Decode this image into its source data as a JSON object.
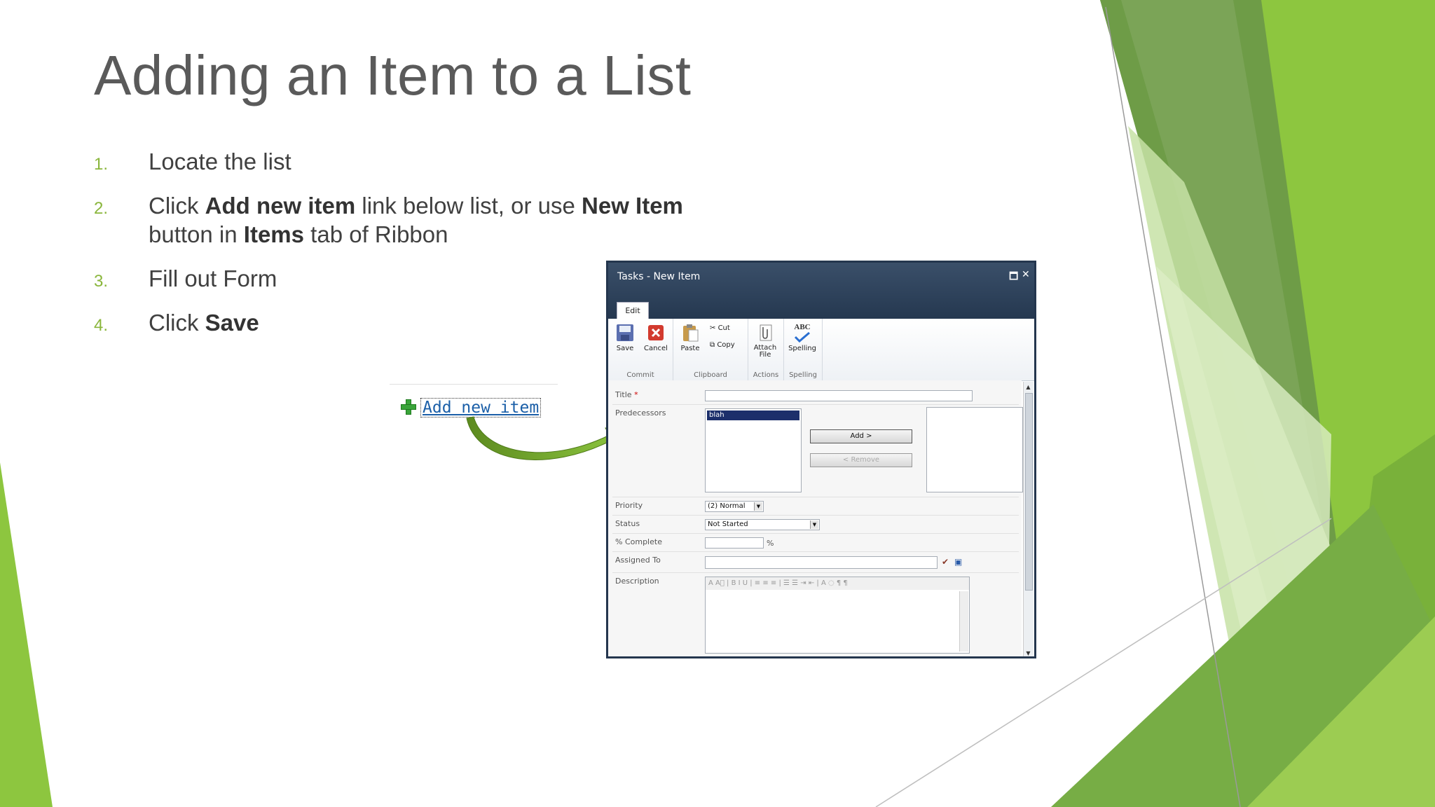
{
  "slide": {
    "title": "Adding an Item to a List",
    "steps": [
      {
        "num": "1.",
        "parts": [
          {
            "t": "Locate the list",
            "b": false
          }
        ]
      },
      {
        "num": "2.",
        "parts": [
          {
            "t": "Click ",
            "b": false
          },
          {
            "t": "Add new item",
            "b": true
          },
          {
            "t": " link below list, or use ",
            "b": false
          },
          {
            "t": "New Item",
            "b": true
          },
          {
            "t": " button in ",
            "b": false
          },
          {
            "t": "Items",
            "b": true
          },
          {
            "t": " tab of Ribbon",
            "b": false
          }
        ]
      },
      {
        "num": "3.",
        "parts": [
          {
            "t": "Fill out Form",
            "b": false
          }
        ]
      },
      {
        "num": "4.",
        "parts": [
          {
            "t": "Click ",
            "b": false
          },
          {
            "t": "Save",
            "b": true
          }
        ]
      }
    ],
    "add_link": "Add new item",
    "accent_colors": [
      "#8dc63f",
      "#6a9a3c",
      "#c5e0a5"
    ]
  },
  "dialog": {
    "title": "Tasks - New Item",
    "restore_glyph": "🗖",
    "close_glyph": "✕",
    "tab": "Edit",
    "groups": {
      "commit": "Commit",
      "clipboard": "Clipboard",
      "actions": "Actions",
      "spelling": "Spelling"
    },
    "buttons": {
      "save": "Save",
      "cancel": "Cancel",
      "paste": "Paste",
      "cut": "Cut",
      "copy": "Copy",
      "attach": "Attach",
      "attach2": "File",
      "spelling": "Spelling",
      "abc": "ABC"
    },
    "fields": {
      "title_label": "Title",
      "required_mark": "*",
      "predecessors_label": "Predecessors",
      "predecessor_item": "blah",
      "add_btn": "Add >",
      "remove_btn": "< Remove",
      "priority_label": "Priority",
      "priority_value": "(2) Normal",
      "status_label": "Status",
      "status_value": "Not Started",
      "complete_label": "% Complete",
      "percent_sign": "%",
      "assigned_label": "Assigned To",
      "description_label": "Description",
      "rte_toolbar": "A  A⃒ | B  I  U | ≡  ≡  ≡ | ☰  ☰  ⇥  ⇤ | A  ◌  ¶  ¶"
    }
  }
}
